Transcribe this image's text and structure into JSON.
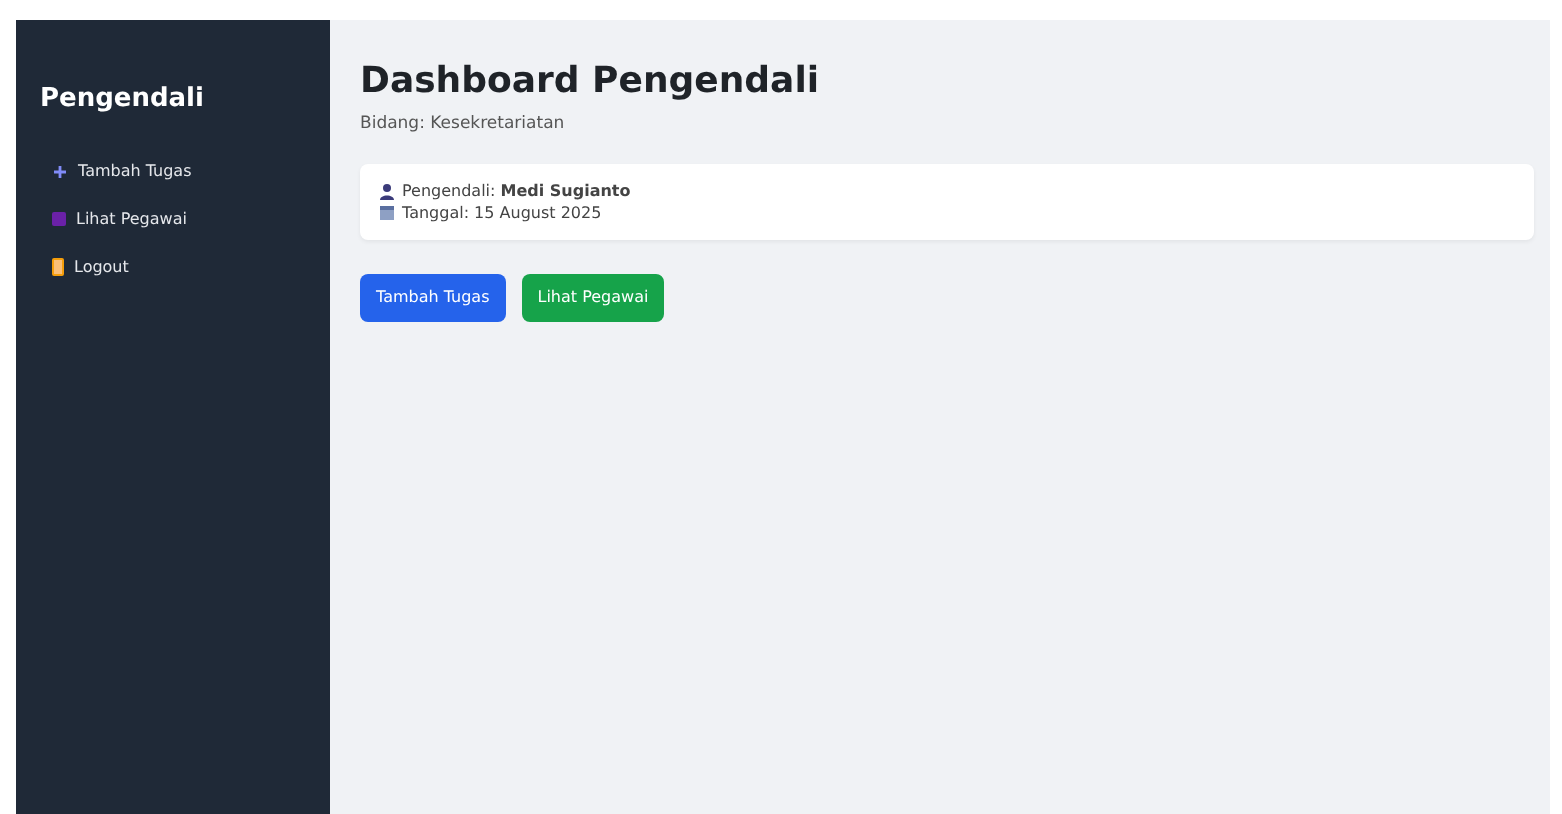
{
  "sidebar": {
    "title": "Pengendali",
    "items": [
      {
        "kind": "add",
        "label": "Tambah Tugas"
      },
      {
        "kind": "list",
        "label": "Lihat Pegawai"
      },
      {
        "kind": "logout",
        "label": "Logout"
      }
    ]
  },
  "main": {
    "title": "Dashboard Pengendali",
    "subtitle": "Bidang: Kesekretariatan",
    "info": [
      {
        "kind": "person",
        "text": "Pengendali: **Medi Sugianto**"
      },
      {
        "kind": "date",
        "text": "Tanggal: 15 August 2025"
      }
    ],
    "buttons": [
      {
        "kind": "primary",
        "label": "Tambah Tugas"
      },
      {
        "kind": "success",
        "label": "Lihat Pegawai"
      }
    ]
  }
}
